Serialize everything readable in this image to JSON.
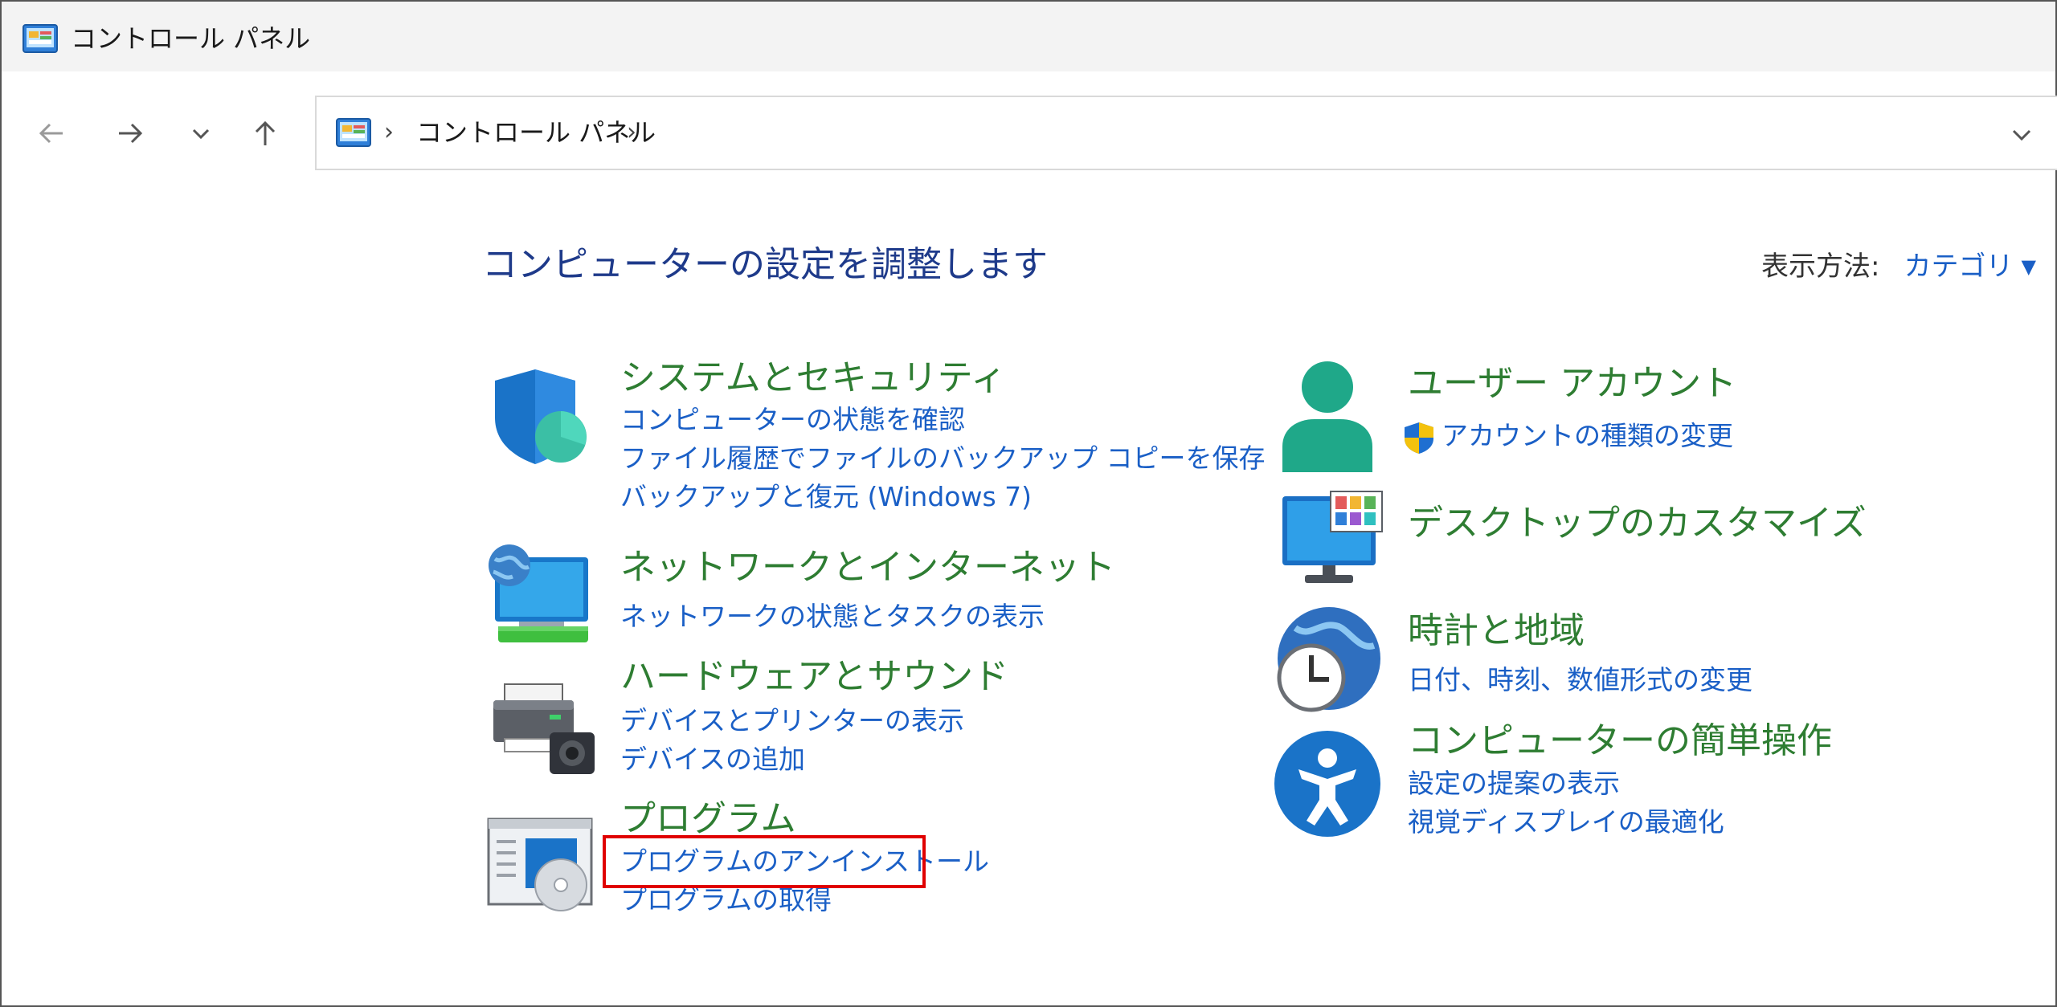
{
  "window": {
    "title": "コントロール パネル"
  },
  "nav": {
    "back_icon": "arrow-left-icon",
    "forward_icon": "arrow-right-icon",
    "recent_icon": "chevron-down-icon",
    "up_icon": "arrow-up-icon"
  },
  "address": {
    "separator": "›",
    "location": "コントロール パネル"
  },
  "main": {
    "heading": "コンピューターの設定を調整します",
    "view_by_label": "表示方法:",
    "view_by_value": "カテゴリ",
    "view_by_arrow": "▼"
  },
  "categories_left": [
    {
      "title": "システムとセキュリティ",
      "icon": "shield-icon",
      "links": [
        "コンピューターの状態を確認",
        "ファイル履歴でファイルのバックアップ コピーを保存",
        "バックアップと復元 (Windows 7)"
      ]
    },
    {
      "title": "ネットワークとインターネット",
      "icon": "network-icon",
      "links": [
        "ネットワークの状態とタスクの表示"
      ]
    },
    {
      "title": "ハードウェアとサウンド",
      "icon": "printer-icon",
      "links": [
        "デバイスとプリンターの表示",
        "デバイスの追加"
      ]
    },
    {
      "title": "プログラム",
      "icon": "programs-icon",
      "links": [
        "プログラムのアンインストール",
        "プログラムの取得"
      ]
    }
  ],
  "categories_right": [
    {
      "title": "ユーザー アカウント",
      "icon": "user-icon",
      "links": [
        "アカウントの種類の変更"
      ]
    },
    {
      "title": "デスクトップのカスタマイズ",
      "icon": "monitor-icon",
      "links": []
    },
    {
      "title": "時計と地域",
      "icon": "clock-globe-icon",
      "links": [
        "日付、時刻、数値形式の変更"
      ]
    },
    {
      "title": "コンピューターの簡単操作",
      "icon": "accessibility-icon",
      "links": [
        "設定の提案の表示",
        "視覚ディスプレイの最適化"
      ]
    }
  ],
  "colors": {
    "category_title": "#2e7d32",
    "link": "#1a5fc6",
    "heading": "#1e3a8a",
    "highlight": "#e00000"
  }
}
